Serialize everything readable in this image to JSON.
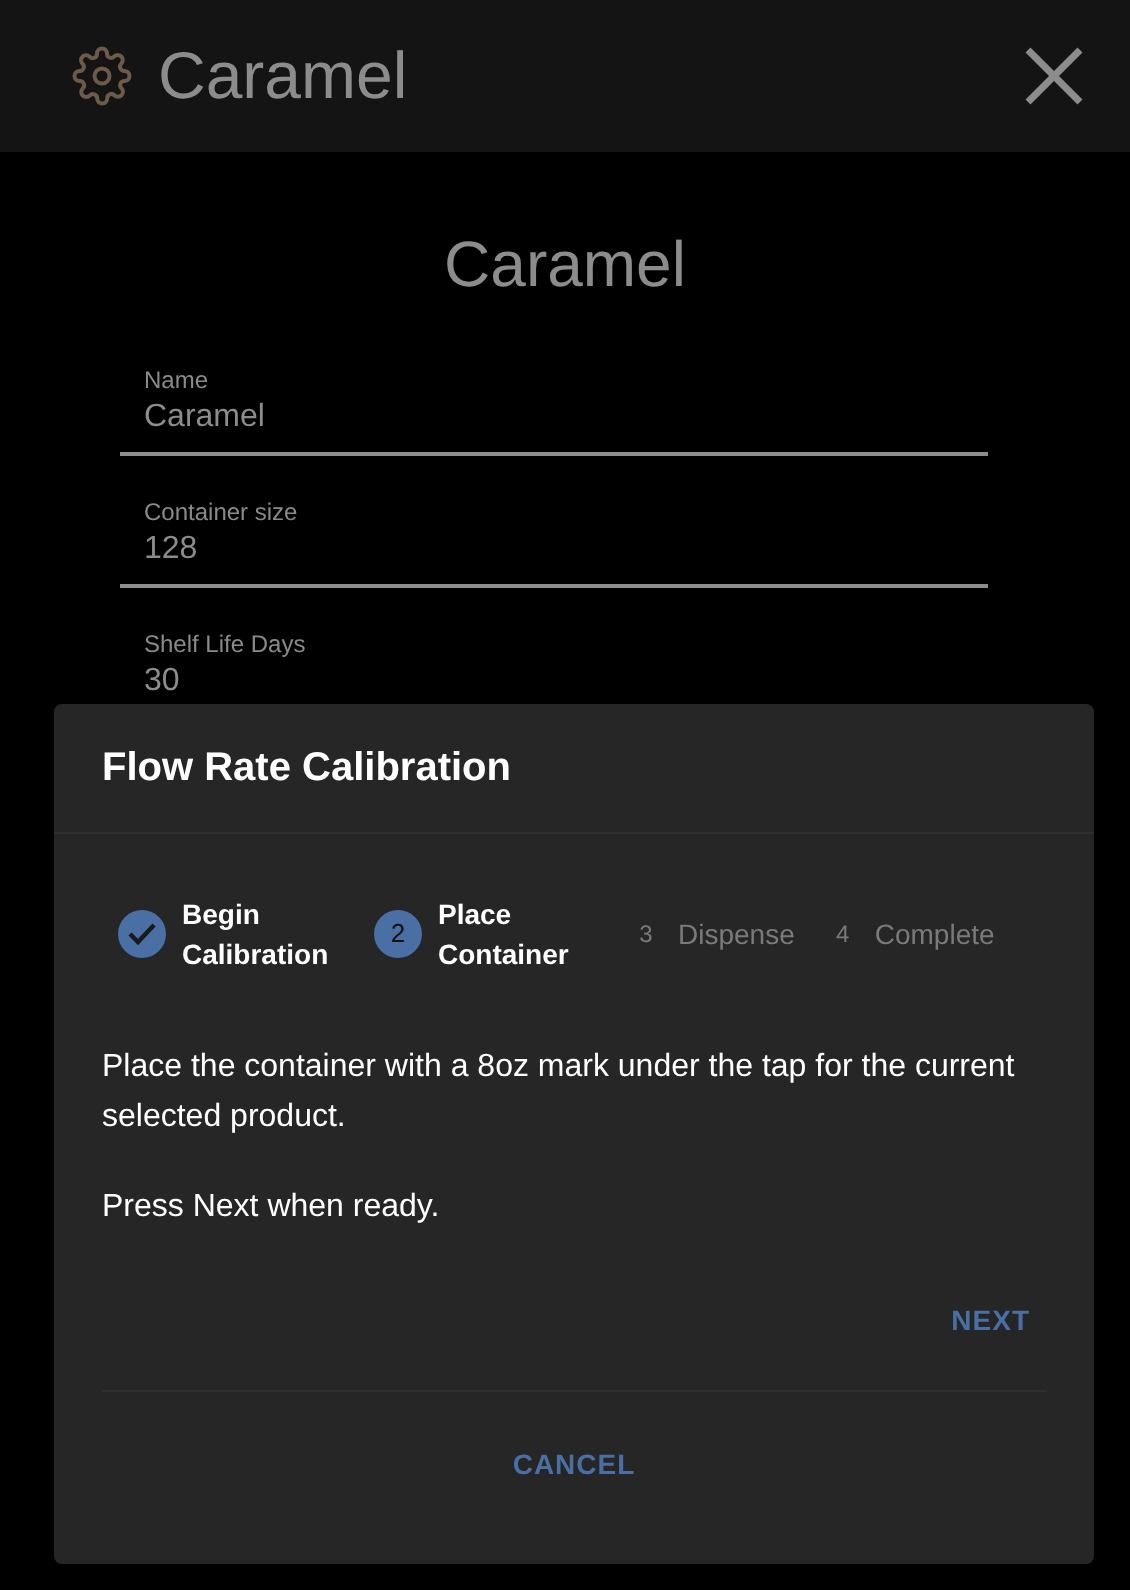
{
  "app_bar": {
    "title": "Caramel"
  },
  "page": {
    "heading": "Caramel",
    "fields": [
      {
        "label": "Name",
        "value": "Caramel"
      },
      {
        "label": "Container size",
        "value": "128"
      },
      {
        "label": "Shelf Life Days",
        "value": "30"
      }
    ]
  },
  "dialog": {
    "title": "Flow Rate Calibration",
    "steps": [
      {
        "label": "Begin Calibration",
        "kind": "completed"
      },
      {
        "number": "2",
        "label": "Place Container",
        "kind": "active"
      },
      {
        "number": "3",
        "label": "Dispense",
        "kind": "pending"
      },
      {
        "number": "4",
        "label": "Complete",
        "kind": "pending"
      }
    ],
    "paragraphs": [
      "Place the container with a 8oz mark under the tap for the current selected product.",
      "Press Next when ready."
    ],
    "next_button": "NEXT",
    "cancel_button": "CANCEL"
  }
}
